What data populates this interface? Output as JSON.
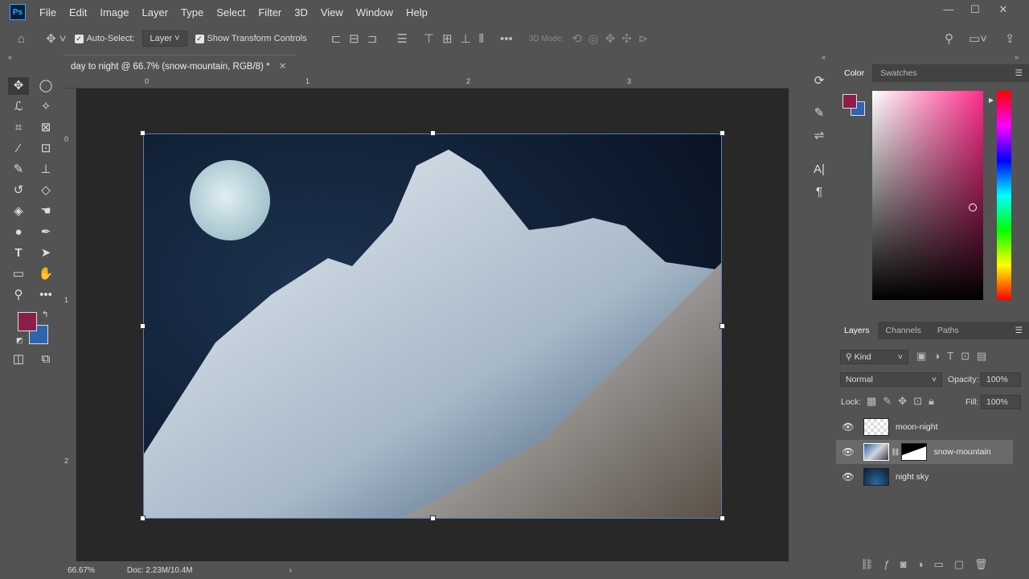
{
  "app": {
    "logo": "Ps"
  },
  "menu": [
    "File",
    "Edit",
    "Image",
    "Layer",
    "Type",
    "Select",
    "Filter",
    "3D",
    "View",
    "Window",
    "Help"
  ],
  "options": {
    "auto_select_label": "Auto-Select:",
    "auto_select_checked": true,
    "target": "Layer",
    "show_transform_label": "Show Transform Controls",
    "show_transform_checked": true,
    "mode_3d_label": "3D Mode:"
  },
  "document": {
    "tab_title": "day to night @ 66.7% (snow-mountain, RGB/8) *",
    "ruler_h": [
      "0",
      "1",
      "2",
      "3"
    ],
    "ruler_v": [
      "0",
      "1",
      "2"
    ]
  },
  "status": {
    "zoom": "66.67%",
    "doc": "Doc: 2.23M/10.4M"
  },
  "colors": {
    "foreground": "#8b1f4a",
    "background": "#2f63b0",
    "accent": "#31a8ff"
  },
  "color_panel": {
    "tabs": [
      "Color",
      "Swatches"
    ],
    "active": "Color"
  },
  "layers_panel": {
    "tabs": [
      "Layers",
      "Channels",
      "Paths"
    ],
    "active": "Layers",
    "filter": "Kind",
    "blend_mode": "Normal",
    "opacity_label": "Opacity:",
    "opacity": "100%",
    "lock_label": "Lock:",
    "fill_label": "Fill:",
    "fill": "100%",
    "layers": [
      {
        "name": "moon-night",
        "visible": true,
        "selected": false
      },
      {
        "name": "snow-mountain",
        "visible": true,
        "selected": true,
        "has_mask": true
      },
      {
        "name": "night sky",
        "visible": true,
        "selected": false
      }
    ]
  }
}
